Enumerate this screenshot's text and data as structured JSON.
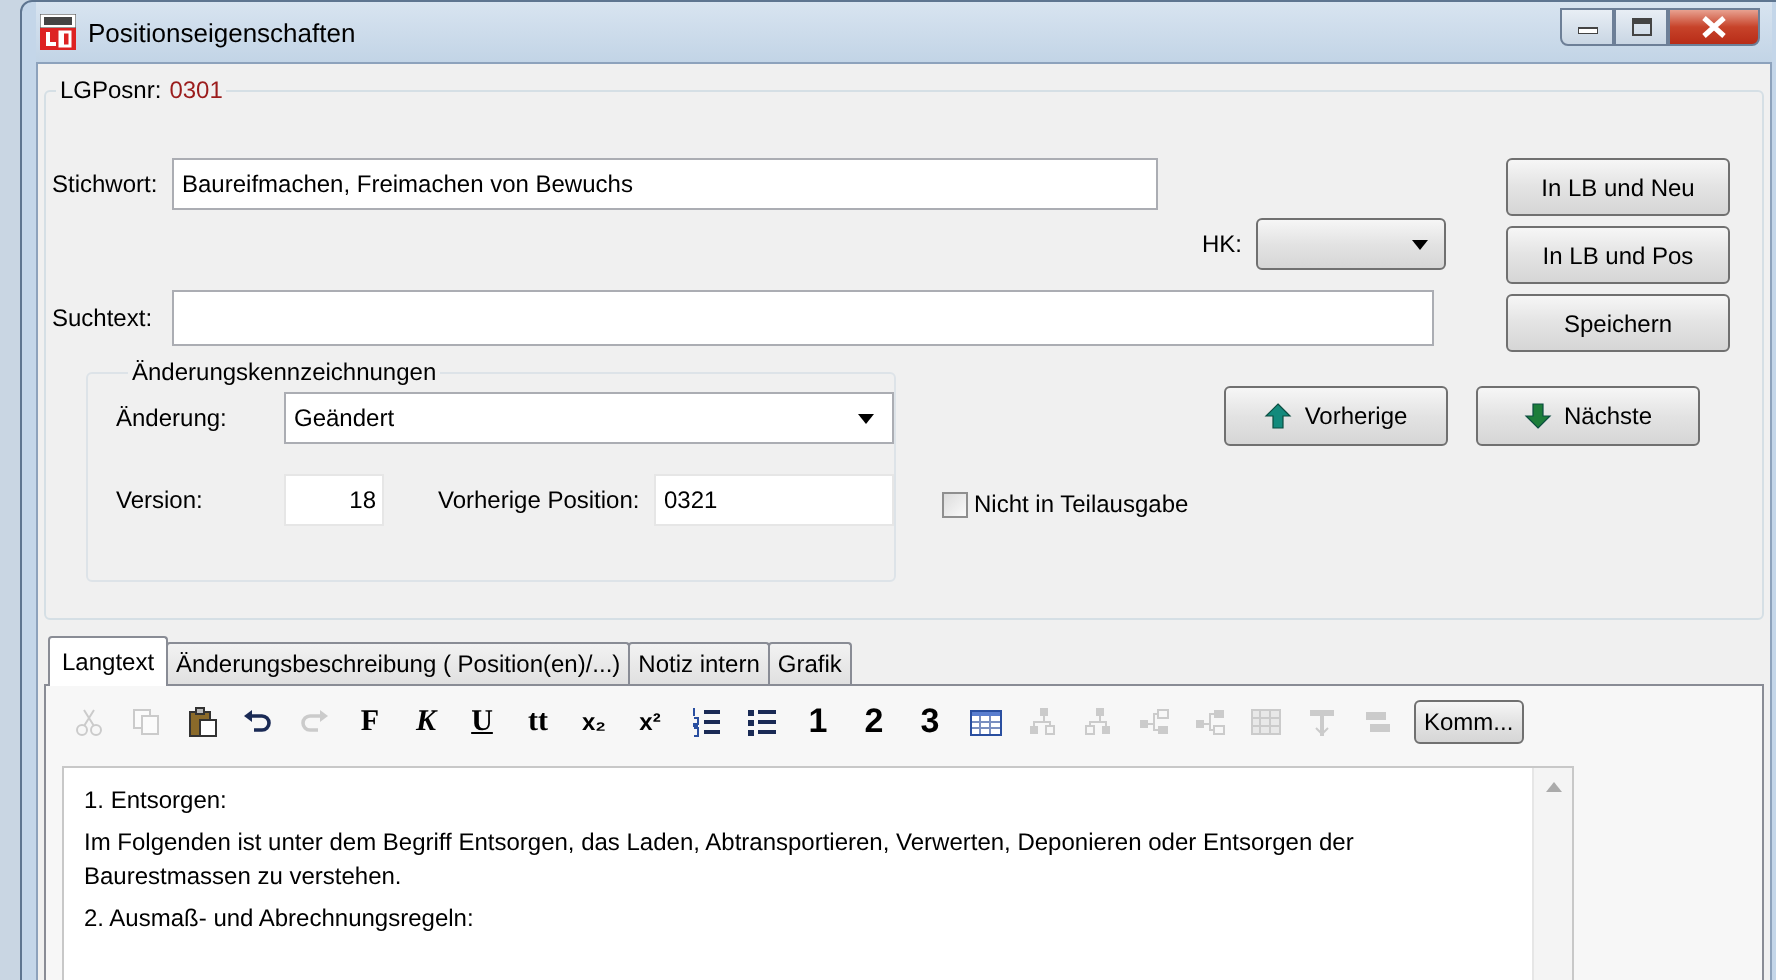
{
  "window": {
    "title": "Positionseigenschaften"
  },
  "position": {
    "label": "LGPosnr:",
    "value": "0301"
  },
  "keyword": {
    "label": "Stichwort:",
    "value": "Baureifmachen, Freimachen von Bewuchs"
  },
  "hk": {
    "label": "HK:"
  },
  "search": {
    "label": "Suchtext:"
  },
  "side_buttons": [
    "In LB und Neu",
    "In LB und Pos",
    "Speichern"
  ],
  "change_marks": {
    "title": "Änderungskennzeichnungen",
    "change_label": "Änderung:",
    "change_value": "Geändert",
    "version_label": "Version:",
    "version_value": "18",
    "previous_label": "Vorherige Position:",
    "previous_value": "0321"
  },
  "nav_buttons": [
    {
      "label": "Vorherige",
      "kind": "up"
    },
    {
      "label": "Nächste",
      "kind": "down"
    }
  ],
  "exclude": {
    "label": "Nicht in Teilausgabe",
    "checked": false
  },
  "tabs": [
    {
      "label": "Langtext",
      "selected": true
    },
    {
      "label": "Änderungsbeschreibung ( Position(en)/...)",
      "selected": false
    },
    {
      "label": "Notiz intern",
      "selected": false
    },
    {
      "label": "Grafik",
      "selected": false
    }
  ],
  "toolbar": [
    {
      "kind": "icon",
      "disabled": true
    },
    {
      "kind": "icon",
      "disabled": true
    },
    {
      "kind": "icon",
      "disabled": false
    },
    {
      "kind": "icon",
      "disabled": false
    },
    {
      "kind": "icon",
      "disabled": true
    },
    {
      "kind": "text",
      "label": "F",
      "disabled": false
    },
    {
      "kind": "text",
      "label": "K",
      "disabled": false
    },
    {
      "kind": "text",
      "label": "U",
      "disabled": false
    },
    {
      "kind": "text",
      "label": "tt",
      "disabled": false
    },
    {
      "kind": "text",
      "label": "x₂",
      "disabled": false
    },
    {
      "kind": "text",
      "label": "x²",
      "disabled": false
    },
    {
      "kind": "icon",
      "disabled": false
    },
    {
      "kind": "icon",
      "disabled": false
    },
    {
      "kind": "text",
      "label": "1",
      "disabled": false
    },
    {
      "kind": "text",
      "label": "2",
      "disabled": false
    },
    {
      "kind": "text",
      "label": "3",
      "disabled": false
    },
    {
      "kind": "icon",
      "disabled": false
    },
    {
      "kind": "icon",
      "disabled": true
    },
    {
      "kind": "icon",
      "disabled": true
    },
    {
      "kind": "icon",
      "disabled": true
    },
    {
      "kind": "icon",
      "disabled": true
    },
    {
      "kind": "icon",
      "disabled": true
    },
    {
      "kind": "icon",
      "disabled": true
    },
    {
      "kind": "icon",
      "disabled": true
    }
  ],
  "toolbar_button": "Komm...",
  "lines": [
    "1. Entsorgen:",
    "Im Folgenden ist unter dem Begriff Entsorgen, das Laden, Abtransportieren, Verwerten, Deponieren oder Entsorgen der Baurestmassen zu verstehen.",
    "2. Ausmaß- und Abrechnungsregeln:"
  ]
}
